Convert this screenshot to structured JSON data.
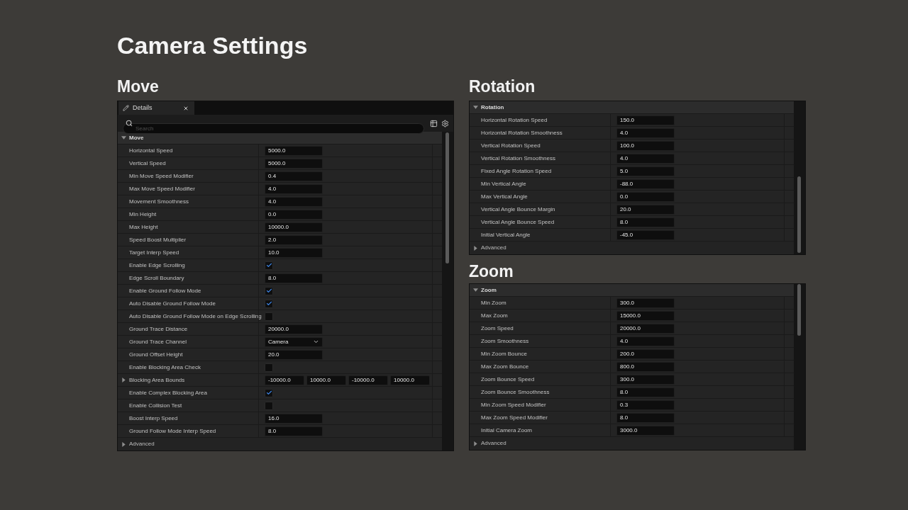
{
  "title": "Camera Settings",
  "sections": [
    {
      "heading": "Move",
      "tabs": [
        {
          "label": "Details",
          "selected": true
        }
      ],
      "search": {
        "placeholder": "Search"
      },
      "category": {
        "label": "Move",
        "expanded": true
      },
      "rows": [
        {
          "label": "Horizontal Speed",
          "kind": "number",
          "value": "5000.0"
        },
        {
          "label": "Vertical Speed",
          "kind": "number",
          "value": "5000.0"
        },
        {
          "label": "Min Move Speed Modifier",
          "kind": "number",
          "value": "0.4"
        },
        {
          "label": "Max Move Speed Modifier",
          "kind": "number",
          "value": "4.0"
        },
        {
          "label": "Movement Smoothness",
          "kind": "number",
          "value": "4.0"
        },
        {
          "label": "Min Height",
          "kind": "number",
          "value": "0.0"
        },
        {
          "label": "Max Height",
          "kind": "number",
          "value": "10000.0"
        },
        {
          "label": "Speed Boost Multiplier",
          "kind": "number",
          "value": "2.0"
        },
        {
          "label": "Target Interp Speed",
          "kind": "number",
          "value": "10.0"
        },
        {
          "label": "Enable Edge Scrolling",
          "kind": "checkbox",
          "checked": true
        },
        {
          "label": "Edge Scroll Boundary",
          "kind": "number",
          "value": "8.0"
        },
        {
          "label": "Enable Ground Follow Mode",
          "kind": "checkbox",
          "checked": true
        },
        {
          "label": "Auto Disable Ground Follow Mode",
          "kind": "checkbox",
          "checked": true
        },
        {
          "label": "Auto Disable Ground Follow Mode on Edge Scrolling",
          "kind": "checkbox",
          "checked": false
        },
        {
          "label": "Ground Trace Distance",
          "kind": "number",
          "value": "20000.0"
        },
        {
          "label": "Ground Trace Channel",
          "kind": "dropdown",
          "value": "Camera"
        },
        {
          "label": "Ground Offset Height",
          "kind": "number",
          "value": "20.0"
        },
        {
          "label": "Enable Blocking Area Check",
          "kind": "checkbox",
          "checked": false
        },
        {
          "label": "Blocking Area Bounds",
          "kind": "vector",
          "expanded": false,
          "values": [
            "-10000.0",
            "10000.0",
            "-10000.0",
            "10000.0"
          ]
        },
        {
          "label": "Enable Complex Blocking Area",
          "kind": "checkbox",
          "checked": true
        },
        {
          "label": "Enable Collision Test",
          "kind": "checkbox",
          "checked": false
        },
        {
          "label": "Boost Interp Speed",
          "kind": "number",
          "value": "16.0"
        },
        {
          "label": "Ground Follow Mode Interp Speed",
          "kind": "number",
          "value": "8.0"
        }
      ],
      "advanced": {
        "label": "Advanced",
        "expanded": false
      }
    },
    {
      "heading": "Rotation",
      "category": {
        "label": "Rotation",
        "expanded": true
      },
      "rows": [
        {
          "label": "Horizontal Rotation Speed",
          "kind": "number",
          "value": "150.0"
        },
        {
          "label": "Horizontal Rotation Smoothness",
          "kind": "number",
          "value": "4.0"
        },
        {
          "label": "Vertical Rotation Speed",
          "kind": "number",
          "value": "100.0"
        },
        {
          "label": "Vertical Rotation Smoothness",
          "kind": "number",
          "value": "4.0"
        },
        {
          "label": "Fixed Angle Rotation Speed",
          "kind": "number",
          "value": "5.0"
        },
        {
          "label": "Min Vertical Angle",
          "kind": "number",
          "value": "-88.0"
        },
        {
          "label": "Max Vertical Angle",
          "kind": "number",
          "value": "0.0"
        },
        {
          "label": "Vertical Angle Bounce Margin",
          "kind": "number",
          "value": "20.0"
        },
        {
          "label": "Vertical Angle Bounce Speed",
          "kind": "number",
          "value": "8.0"
        },
        {
          "label": "Initial Vertical Angle",
          "kind": "number",
          "value": "-45.0"
        }
      ],
      "advanced": {
        "label": "Advanced",
        "expanded": false
      }
    },
    {
      "heading": "Zoom",
      "category": {
        "label": "Zoom",
        "expanded": true
      },
      "rows": [
        {
          "label": "Min Zoom",
          "kind": "number",
          "value": "300.0"
        },
        {
          "label": "Max Zoom",
          "kind": "number",
          "value": "15000.0"
        },
        {
          "label": "Zoom Speed",
          "kind": "number",
          "value": "20000.0"
        },
        {
          "label": "Zoom Smoothness",
          "kind": "number",
          "value": "4.0"
        },
        {
          "label": "Min Zoom Bounce",
          "kind": "number",
          "value": "200.0"
        },
        {
          "label": "Max Zoom Bounce",
          "kind": "number",
          "value": "800.0"
        },
        {
          "label": "Zoom Bounce Speed",
          "kind": "number",
          "value": "300.0"
        },
        {
          "label": "Zoom Bounce Smoothness",
          "kind": "number",
          "value": "8.0"
        },
        {
          "label": "Min Zoom Speed Modifier",
          "kind": "number",
          "value": "0.3"
        },
        {
          "label": "Max Zoom Speed Modifier",
          "kind": "number",
          "value": "8.0"
        },
        {
          "label": "Initial Camera Zoom",
          "kind": "number",
          "value": "3000.0"
        }
      ],
      "advanced": {
        "label": "Advanced",
        "expanded": false
      }
    }
  ]
}
